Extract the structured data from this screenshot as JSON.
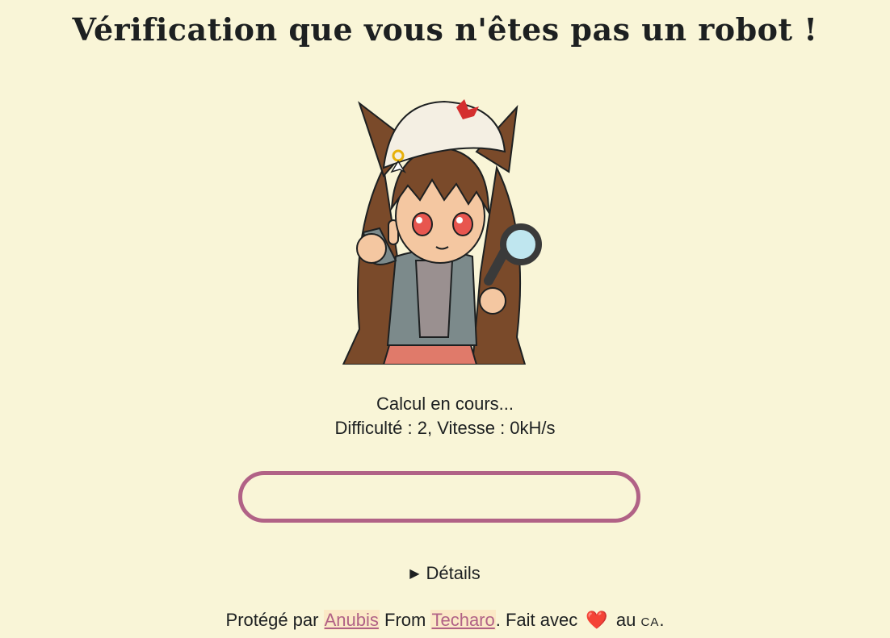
{
  "page": {
    "title": "Vérification que vous n'êtes pas un robot !"
  },
  "status": {
    "line1": "Calcul en cours...",
    "line2": "Difficulté : 2, Vitesse : 0kH/s"
  },
  "progress": {
    "fraction": 0,
    "color": "#b16286"
  },
  "details": {
    "label": "Détails"
  },
  "footer": {
    "prefix": "Protégé par",
    "anubis": "Anubis",
    "middle": "From",
    "techaro": "Techaro",
    "suffix": ". Fait avec",
    "heart": "❤️",
    "au": "au",
    "country": "CA",
    "end": "."
  },
  "colors": {
    "background": "#f9f5d7",
    "accent": "#b16286",
    "text": "#1d2021"
  }
}
